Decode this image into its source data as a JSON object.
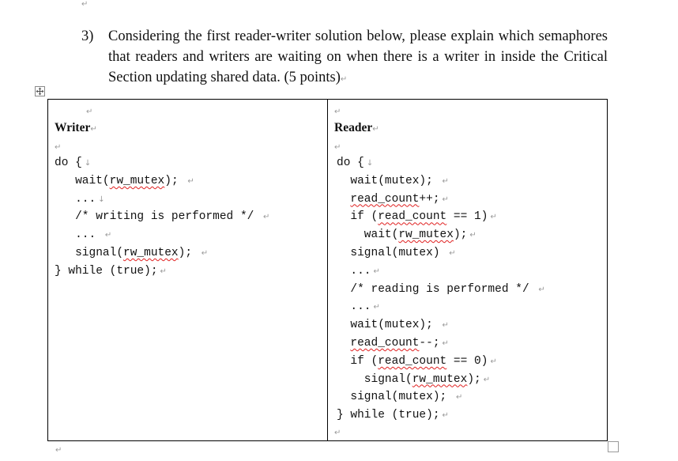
{
  "paragraph_mark": "↵",
  "line_break_mark": "↓",
  "question": {
    "number": "3)",
    "text": "Considering the first reader-writer solution below, please explain which semaphores that readers and writers are waiting on when there is a writer in inside the Critical Section updating shared data. (5 points)"
  },
  "table": {
    "writer": {
      "heading": "Writer",
      "lines": [
        {
          "pre": "do {",
          "sq": "",
          "post": ""
        },
        {
          "pre": "   wait(",
          "sq": "rw_mutex",
          "post": "); "
        },
        {
          "pre": "   ...",
          "sq": "",
          "post": ""
        },
        {
          "pre": "   /* writing is performed */ ",
          "sq": "",
          "post": ""
        },
        {
          "pre": "   ... ",
          "sq": "",
          "post": ""
        },
        {
          "pre": "   signal(",
          "sq": "rw_mutex",
          "post": "); "
        },
        {
          "pre": "} while (true);",
          "sq": "",
          "post": ""
        }
      ]
    },
    "reader": {
      "heading": "Reader",
      "lines": [
        {
          "pre": "do {",
          "sq": "",
          "post": ""
        },
        {
          "pre": "  wait(mutex); ",
          "sq": "",
          "post": ""
        },
        {
          "pre": "  ",
          "sq": "read_count",
          "post": "++;"
        },
        {
          "pre": "  if (",
          "sq": "read_count",
          "post": " == 1)"
        },
        {
          "pre": "    wait(",
          "sq": "rw_mutex",
          "post": ");"
        },
        {
          "pre": "  signal(mutex) ",
          "sq": "",
          "post": ""
        },
        {
          "pre": "  ...",
          "sq": "",
          "post": ""
        },
        {
          "pre": "  /* reading is performed */ ",
          "sq": "",
          "post": ""
        },
        {
          "pre": "  ...",
          "sq": "",
          "post": ""
        },
        {
          "pre": "  wait(mutex); ",
          "sq": "",
          "post": ""
        },
        {
          "pre": "  ",
          "sq": "read_count",
          "post": "--;"
        },
        {
          "pre": "  if (",
          "sq": "read_count",
          "post": " == 0)"
        },
        {
          "pre": "    signal(",
          "sq": "rw_mutex",
          "post": ");"
        },
        {
          "pre": "  signal(mutex); ",
          "sq": "",
          "post": ""
        },
        {
          "pre": "} while (true);",
          "sq": "",
          "post": ""
        }
      ]
    }
  },
  "colors": {
    "spellcheck_underline": "#e02020",
    "formatting_marks": "#9a9a9a",
    "border": "#000000"
  }
}
